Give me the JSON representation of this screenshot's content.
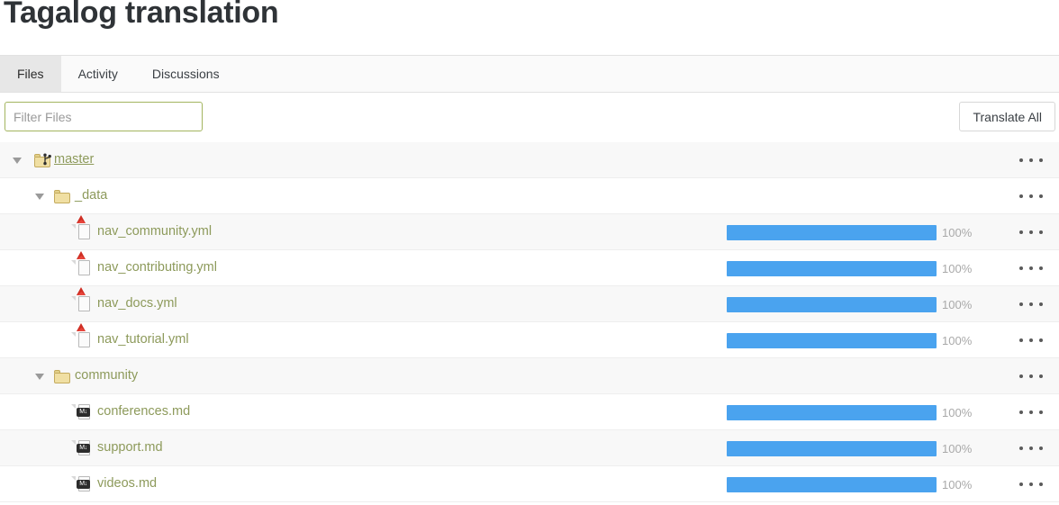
{
  "header": {
    "title": "Tagalog translation"
  },
  "tabs": [
    {
      "label": "Files",
      "active": true,
      "name": "tab-files"
    },
    {
      "label": "Activity",
      "active": false,
      "name": "tab-activity"
    },
    {
      "label": "Discussions",
      "active": false,
      "name": "tab-discussions"
    }
  ],
  "toolbar": {
    "filter_placeholder": "Filter Files",
    "filter_value": "",
    "translate_all_label": "Translate All"
  },
  "colors": {
    "progress_fill": "#4aa3ef",
    "progress_track": "#f2f2f2",
    "link_text": "#8d9a5b",
    "active_tab_bg": "#e7e7e7",
    "input_focus_border": "#a3b55f",
    "row_stripe": "#f8f8f8"
  },
  "tree": {
    "menu_icon": "ellipsis-icon",
    "rows": [
      {
        "name": "master",
        "type": "branch",
        "icon": "branch-folder-icon",
        "depth": 0,
        "expanded": true,
        "is_link": true,
        "stripe": true,
        "progress": null,
        "percent_label": null
      },
      {
        "name": "_data",
        "type": "folder",
        "icon": "folder-icon",
        "depth": 1,
        "expanded": true,
        "is_link": false,
        "stripe": false,
        "progress": null,
        "percent_label": null
      },
      {
        "name": "nav_community.yml",
        "type": "file",
        "icon": "yaml-file-icon",
        "depth": 2,
        "expanded": null,
        "is_link": false,
        "stripe": true,
        "progress": 100,
        "percent_label": "100%"
      },
      {
        "name": "nav_contributing.yml",
        "type": "file",
        "icon": "yaml-file-icon",
        "depth": 2,
        "expanded": null,
        "is_link": false,
        "stripe": false,
        "progress": 100,
        "percent_label": "100%"
      },
      {
        "name": "nav_docs.yml",
        "type": "file",
        "icon": "yaml-file-icon",
        "depth": 2,
        "expanded": null,
        "is_link": false,
        "stripe": true,
        "progress": 100,
        "percent_label": "100%"
      },
      {
        "name": "nav_tutorial.yml",
        "type": "file",
        "icon": "yaml-file-icon",
        "depth": 2,
        "expanded": null,
        "is_link": false,
        "stripe": false,
        "progress": 100,
        "percent_label": "100%"
      },
      {
        "name": "community",
        "type": "folder",
        "icon": "folder-icon",
        "depth": 1,
        "expanded": true,
        "is_link": false,
        "stripe": true,
        "progress": null,
        "percent_label": null
      },
      {
        "name": "conferences.md",
        "type": "file",
        "icon": "markdown-file-icon",
        "depth": 2,
        "expanded": null,
        "is_link": false,
        "stripe": false,
        "progress": 100,
        "percent_label": "100%"
      },
      {
        "name": "support.md",
        "type": "file",
        "icon": "markdown-file-icon",
        "depth": 2,
        "expanded": null,
        "is_link": false,
        "stripe": true,
        "progress": 100,
        "percent_label": "100%"
      },
      {
        "name": "videos.md",
        "type": "file",
        "icon": "markdown-file-icon",
        "depth": 2,
        "expanded": null,
        "is_link": false,
        "stripe": false,
        "progress": 100,
        "percent_label": "100%"
      }
    ]
  }
}
